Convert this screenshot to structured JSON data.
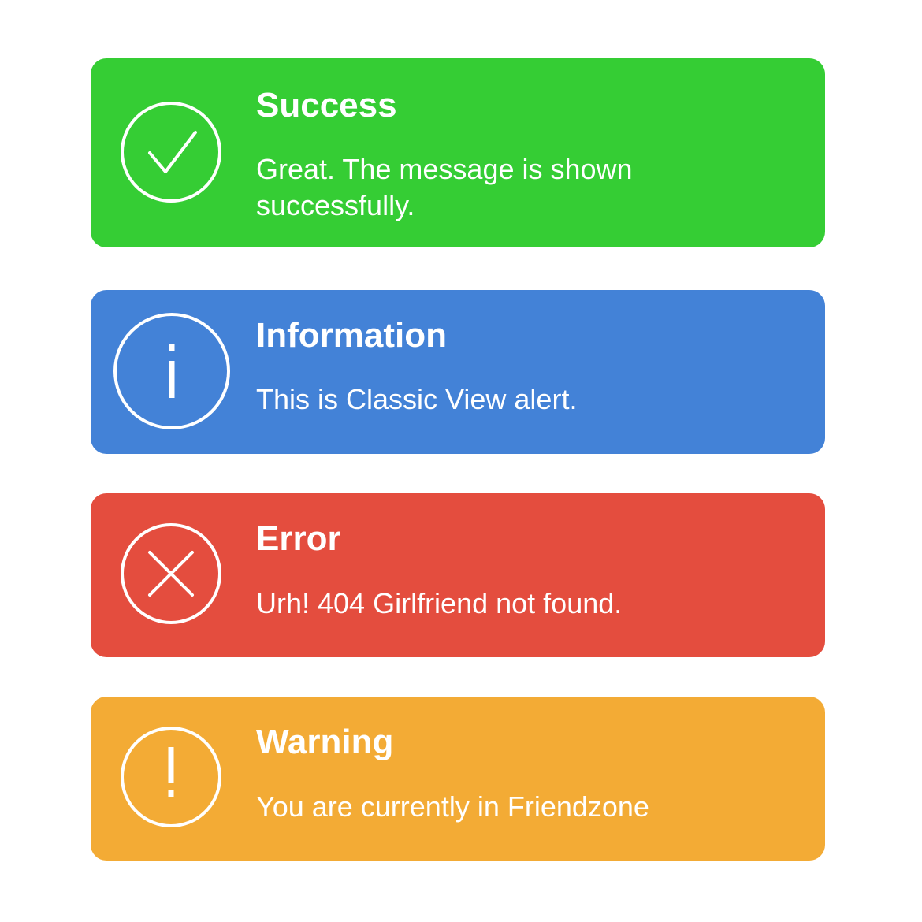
{
  "alerts": [
    {
      "kind": "success",
      "icon": "checkmark-circle-icon",
      "color": "#35CD34",
      "title": "Success",
      "message": "Great. The message is shown successfully."
    },
    {
      "kind": "information",
      "icon": "info-circle-icon",
      "color": "#4382D7",
      "title": "Information",
      "message": "This is Classic View alert."
    },
    {
      "kind": "error",
      "icon": "x-circle-icon",
      "color": "#E44D3E",
      "title": "Error",
      "message": "Urh! 404 Girlfriend not found."
    },
    {
      "kind": "warning",
      "icon": "exclamation-circle-icon",
      "color": "#F3AB35",
      "title": "Warning",
      "message": "You are currently in Friendzone"
    }
  ]
}
